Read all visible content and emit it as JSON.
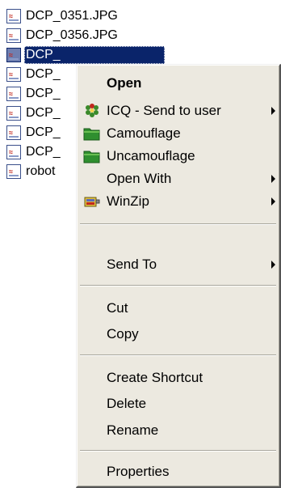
{
  "files": [
    {
      "name": "DCP_0351.JPG",
      "selected": false
    },
    {
      "name": "DCP_0356.JPG",
      "selected": false
    },
    {
      "name": "DCP_",
      "selected": true
    },
    {
      "name": "DCP_",
      "selected": false
    },
    {
      "name": "DCP_",
      "selected": false
    },
    {
      "name": "DCP_",
      "selected": false
    },
    {
      "name": "DCP_",
      "selected": false
    },
    {
      "name": "DCP_",
      "selected": false
    },
    {
      "name": "robot",
      "selected": false
    }
  ],
  "menu": {
    "open": "Open",
    "icq": "ICQ - Send to user",
    "camouflage": "Camouflage",
    "uncamouflage": "Uncamouflage",
    "open_with": "Open With",
    "winzip": "WinZip",
    "send_to": "Send To",
    "cut": "Cut",
    "copy": "Copy",
    "create_shortcut": "Create Shortcut",
    "delete": "Delete",
    "rename": "Rename",
    "properties": "Properties"
  },
  "icons": {
    "file": "jpeg-file-icon",
    "icq": "icq-flower-icon",
    "camouflage": "green-folder-icon",
    "uncamouflage": "green-folder-icon",
    "winzip": "winzip-vise-icon",
    "submenu": "submenu-arrow-icon"
  },
  "colors": {
    "selection": "#0a246a",
    "menu_background": "#ece9e0",
    "folder_green": "#2f8f2f"
  }
}
